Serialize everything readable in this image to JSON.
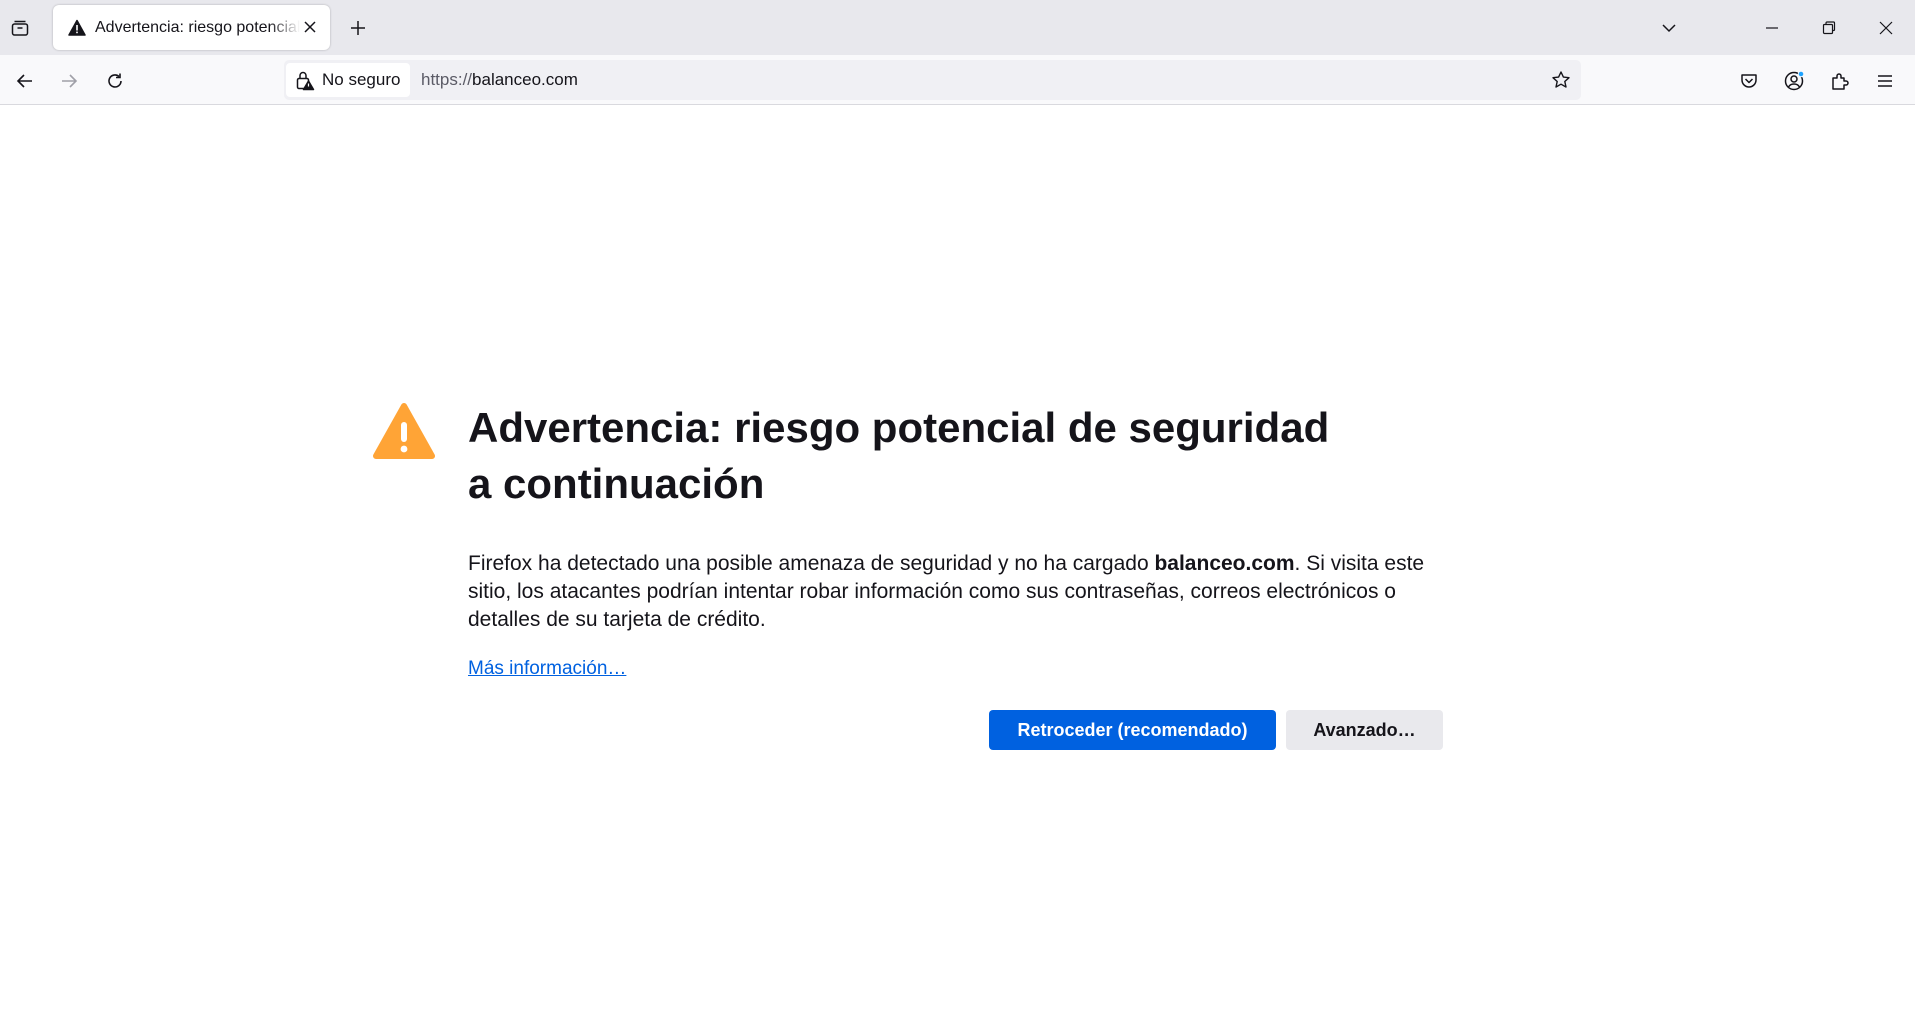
{
  "colors": {
    "warning": "#ffa436",
    "primary_button": "#0061e0",
    "link": "#0061e0",
    "tabstrip_bg": "#e8e8ed",
    "account_badge": "#1fa3ff"
  },
  "tab": {
    "title": "Advertencia: riesgo potencial de seguridad a continuación",
    "icon": "warning-triangle-icon"
  },
  "urlbar": {
    "identity_label": "No seguro",
    "identity_icon": "insecure-lock-icon",
    "url_scheme": "https://",
    "url_host": "balanceo.com"
  },
  "error_page": {
    "title": "Advertencia: riesgo potencial de seguridad a continuación",
    "description_before": "Firefox ha detectado una posible amenaza de seguridad y no ha cargado ",
    "description_host": "balanceo.com",
    "description_after": ". Si visita este sitio, los atacantes podrían intentar robar información como sus contraseñas, correos electrónicos o detalles de su tarjeta de crédito.",
    "learn_more": "Más información…",
    "go_back_button": "Retroceder (recomendado)",
    "advanced_button": "Avanzado…"
  }
}
